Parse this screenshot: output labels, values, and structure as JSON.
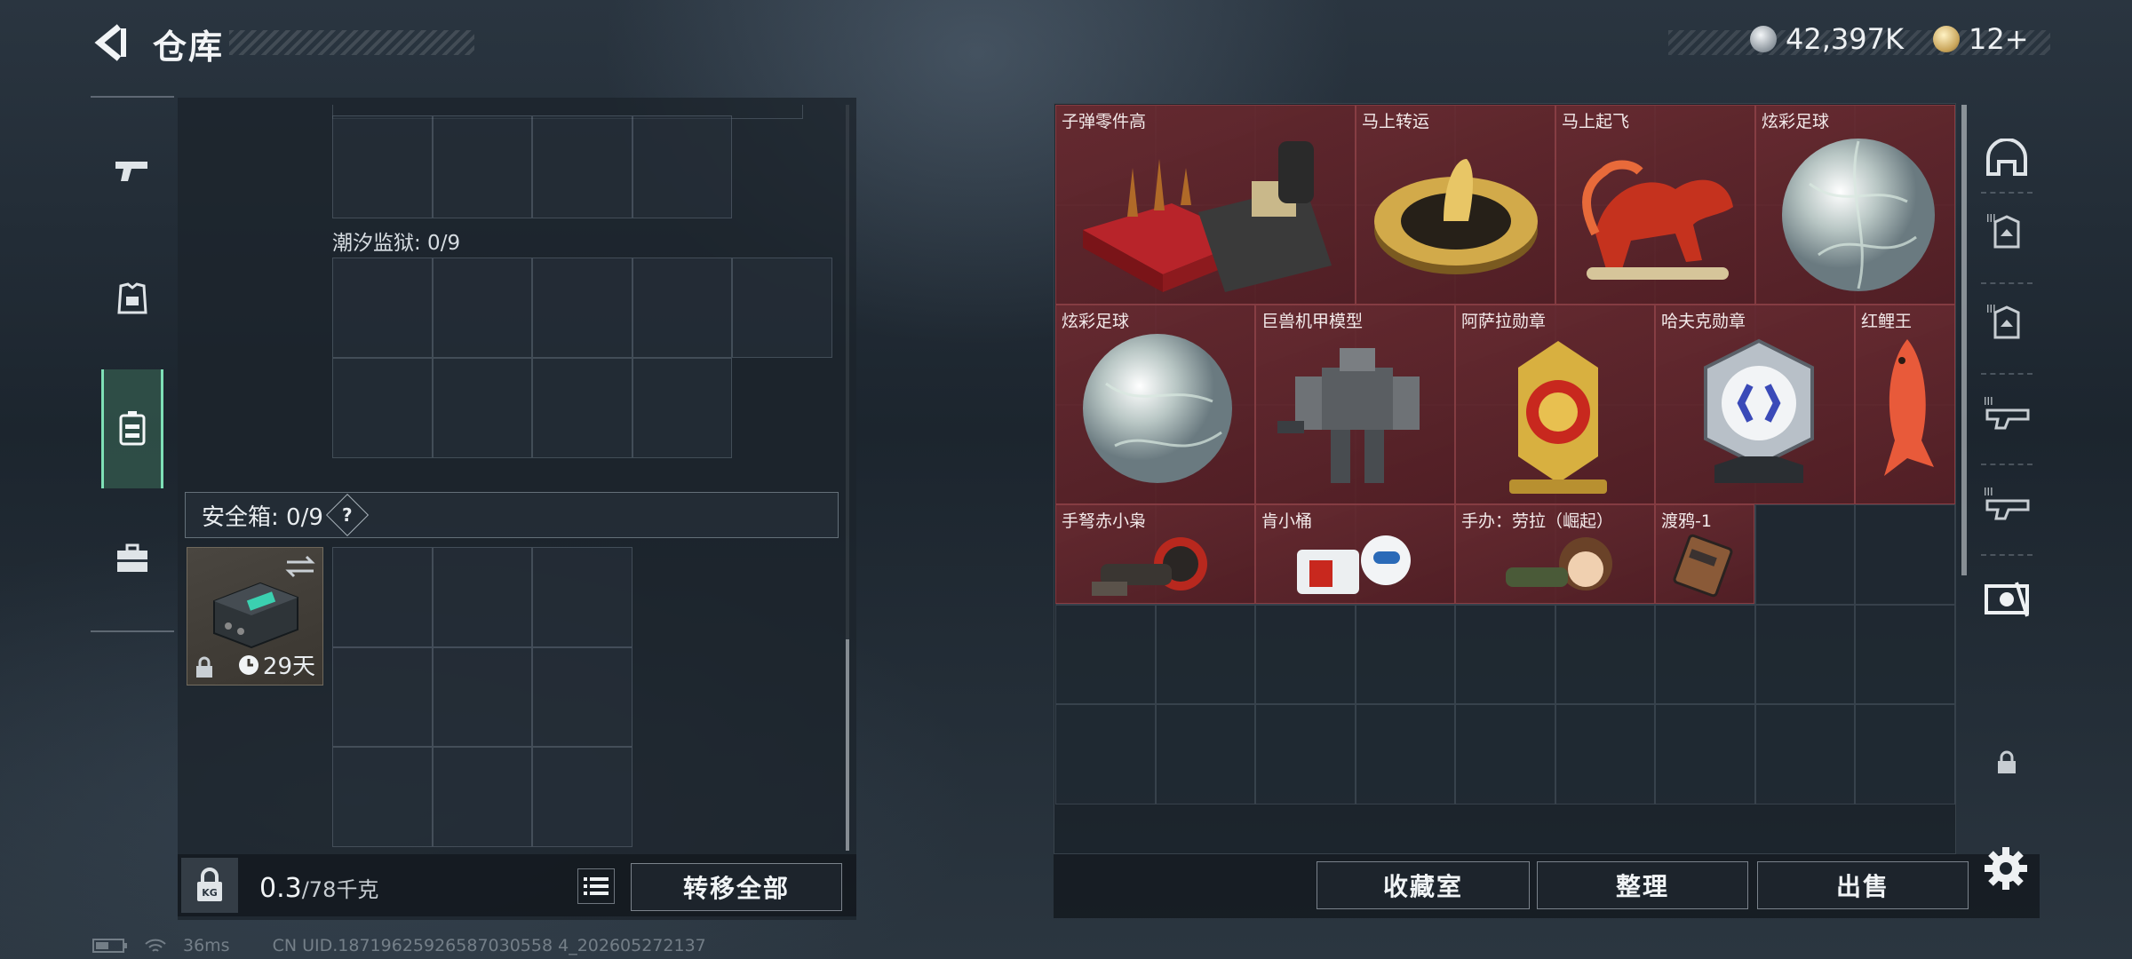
{
  "header": {
    "title": "仓库",
    "currency_main": "42,397K",
    "currency_secondary": "12+"
  },
  "left_tabs": [
    {
      "icon": "pistol-icon",
      "active": false
    },
    {
      "icon": "armor-icon",
      "active": false
    },
    {
      "icon": "backpack-icon",
      "active": true
    },
    {
      "icon": "toolkit-icon",
      "active": false
    }
  ],
  "containers": {
    "tide_prison_label": "潮汐监狱: 0/9",
    "safe_box_label": "安全箱: 0/9",
    "safe_box_help": "?",
    "safe_case_days": "29天"
  },
  "bottom_left": {
    "weight_current": "0.3",
    "weight_max": "/78千克",
    "transfer_all": "转移全部"
  },
  "items": [
    {
      "name": "子弹零件高"
    },
    {
      "name": "马上转运"
    },
    {
      "name": "马上起飞"
    },
    {
      "name": "炫彩足球"
    },
    {
      "name": "炫彩足球"
    },
    {
      "name": "巨兽机甲模型"
    },
    {
      "name": "阿萨拉勋章"
    },
    {
      "name": "哈夫克勋章"
    },
    {
      "name": "红鲤王"
    },
    {
      "name": "手弩赤小枭"
    },
    {
      "name": "肯小桶"
    },
    {
      "name": "手办：劳拉（崛起）"
    },
    {
      "name": "渡鸦-1"
    }
  ],
  "bottom_right": {
    "collection": "收藏室",
    "organize": "整理",
    "sell": "出售"
  },
  "right_rail": [
    "helmet-slot-icon",
    "armor-slot-1-icon",
    "armor-slot-2-icon",
    "weapon-slot-1-icon",
    "weapon-slot-2-icon",
    "ticket-icon",
    "lock-icon",
    "gear-icon"
  ],
  "status_bar": {
    "ping": "36ms",
    "uid": "CN UID.18719625926587030558 4_202605272137"
  }
}
